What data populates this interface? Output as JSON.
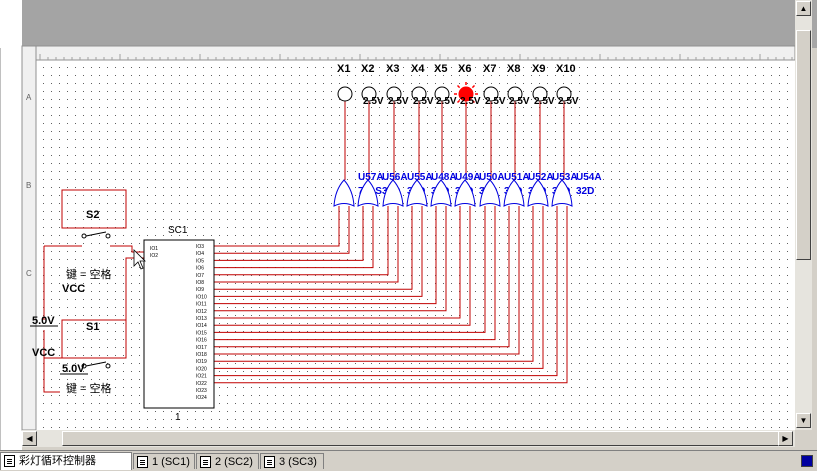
{
  "schematic": {
    "probes": [
      "X1",
      "X2",
      "X3",
      "X4",
      "X5",
      "X6",
      "X7",
      "X8",
      "X9",
      "X10"
    ],
    "voltage_labels": [
      "2.5V",
      "2.5V",
      "2.5V",
      "2.5V",
      "2.5V",
      "2.5V",
      "2.5V",
      "2.5V",
      "2.5V",
      "2.5V"
    ],
    "active_probe": "X6",
    "lamp_on_color": "#ff0000",
    "wire_color": "#c00000",
    "gate_color": "#0000e0",
    "gate_top_row": [
      "U57A",
      "U56A",
      "U55A",
      "U48A",
      "U49A",
      "U50A",
      "U51A",
      "U52A",
      "U53A",
      "U54A"
    ],
    "gate_part": "74LS32D",
    "gate_bottom_row": [
      "74LS",
      "32D",
      "32D",
      "32D",
      "32D",
      "32D",
      "32D",
      "32D",
      "32D",
      "32D"
    ],
    "subcircuit_ref": "SC1",
    "subcircuit_bottom_label": "1",
    "subcircuit_pins_left": [
      "IO1",
      "IO2"
    ],
    "subcircuit_pins_right": [
      "IO3",
      "IO4",
      "IO5",
      "IO6",
      "IO7",
      "IO8",
      "IO9",
      "IO10",
      "IO11",
      "IO12",
      "IO13",
      "IO14",
      "IO15",
      "IO16",
      "IO17",
      "IO18",
      "IO19",
      "IO20",
      "IO21",
      "IO22",
      "IO23",
      "IO24"
    ],
    "switch_s2": "S2",
    "switch_s1": "S1",
    "key_label_s2": "键 = 空格",
    "key_label_s1": "键 = 空格",
    "vcc_labels": [
      "VCC",
      "VCC"
    ],
    "vcc_voltages": [
      "5.0V",
      "5.0V"
    ],
    "ruler_rows": [
      "A",
      "B",
      "C"
    ]
  },
  "tabs": [
    {
      "label": "彩灯循环控制器",
      "active": true
    },
    {
      "label": "1 (SC1)",
      "active": false
    },
    {
      "label": "2 (SC2)",
      "active": false
    },
    {
      "label": "3 (SC3)",
      "active": false
    }
  ]
}
